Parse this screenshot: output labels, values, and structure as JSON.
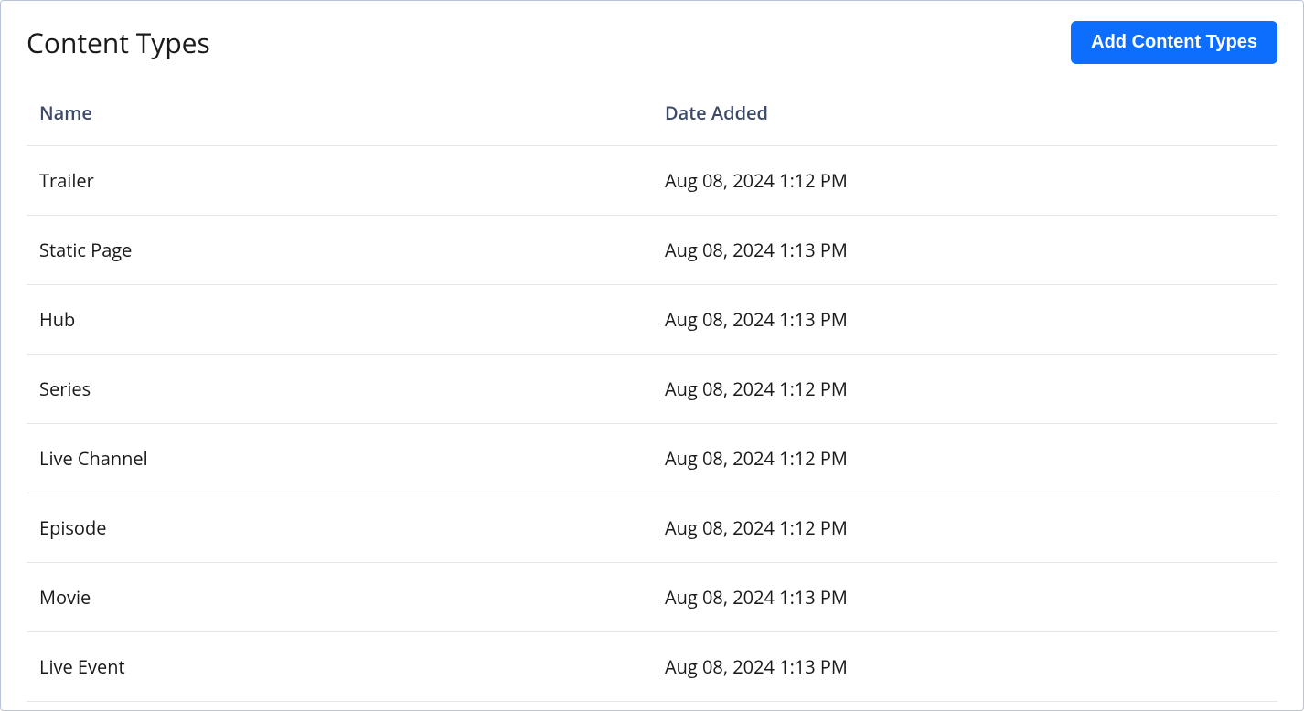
{
  "header": {
    "title": "Content Types",
    "add_button_label": "Add Content Types"
  },
  "table": {
    "columns": {
      "name": "Name",
      "date": "Date Added"
    },
    "rows": [
      {
        "name": "Trailer",
        "date": "Aug 08, 2024 1:12 PM"
      },
      {
        "name": "Static Page",
        "date": "Aug 08, 2024 1:13 PM"
      },
      {
        "name": "Hub",
        "date": "Aug 08, 2024 1:13 PM"
      },
      {
        "name": "Series",
        "date": "Aug 08, 2024 1:12 PM"
      },
      {
        "name": "Live Channel",
        "date": "Aug 08, 2024 1:12 PM"
      },
      {
        "name": "Episode",
        "date": "Aug 08, 2024 1:12 PM"
      },
      {
        "name": "Movie",
        "date": "Aug 08, 2024 1:13 PM"
      },
      {
        "name": "Live Event",
        "date": "Aug 08, 2024 1:13 PM"
      }
    ]
  }
}
